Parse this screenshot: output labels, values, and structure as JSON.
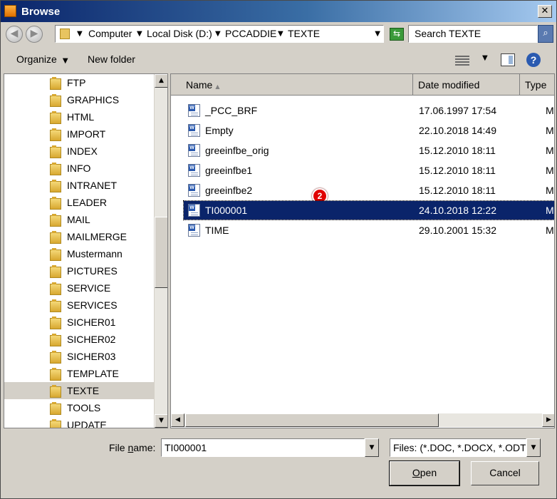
{
  "window": {
    "title": "Browse",
    "close_glyph": "✕"
  },
  "address": {
    "back_glyph": "◀",
    "forward_glyph": "▶",
    "crumbs": [
      "Computer",
      "Local Disk (D:)",
      "PCCADDIE",
      "TEXTE"
    ],
    "refresh_glyph": "⇆",
    "search_placeholder": "Search TEXTE",
    "search_glyph": "⌕"
  },
  "toolbar": {
    "organize": "Organize",
    "new_folder": "New folder",
    "help": "?"
  },
  "tree": {
    "items": [
      "FTP",
      "GRAPHICS",
      "HTML",
      "IMPORT",
      "INDEX",
      "INFO",
      "INTRANET",
      "LEADER",
      "MAIL",
      "MAILMERGE",
      "Mustermann",
      "PICTURES",
      "SERVICE",
      "SERVICES",
      "SICHER01",
      "SICHER02",
      "SICHER03",
      "TEMPLATE",
      "TEXTE",
      "TOOLS",
      "UPDATE"
    ],
    "selected_index": 18
  },
  "files": {
    "headers": {
      "name": "Name",
      "date": "Date modified",
      "type": "Type"
    },
    "rows": [
      {
        "name": "_PCC_BRF",
        "date": "17.06.1997 17:54",
        "type": "Microso"
      },
      {
        "name": "Empty",
        "date": "22.10.2018 14:49",
        "type": "Microso"
      },
      {
        "name": "greeinfbe_orig",
        "date": "15.12.2010 18:11",
        "type": "Microso"
      },
      {
        "name": "greeinfbe1",
        "date": "15.12.2010 18:11",
        "type": "Microso"
      },
      {
        "name": "greeinfbe2",
        "date": "15.12.2010 18:11",
        "type": "Microso"
      },
      {
        "name": "TI000001",
        "date": "24.10.2018 12:22",
        "type": "Microso"
      },
      {
        "name": "TIME",
        "date": "29.10.2001 15:32",
        "type": "Microso"
      }
    ],
    "selected_index": 5,
    "badge": "2"
  },
  "bottom": {
    "file_name_label_pre": "File ",
    "file_name_label_u": "n",
    "file_name_label_post": "ame:",
    "file_name_value": "TI000001",
    "filter_value": "Files: (*.DOC, *.DOCX, *.ODT,",
    "open_u": "O",
    "open_rest": "pen",
    "cancel": "Cancel"
  }
}
